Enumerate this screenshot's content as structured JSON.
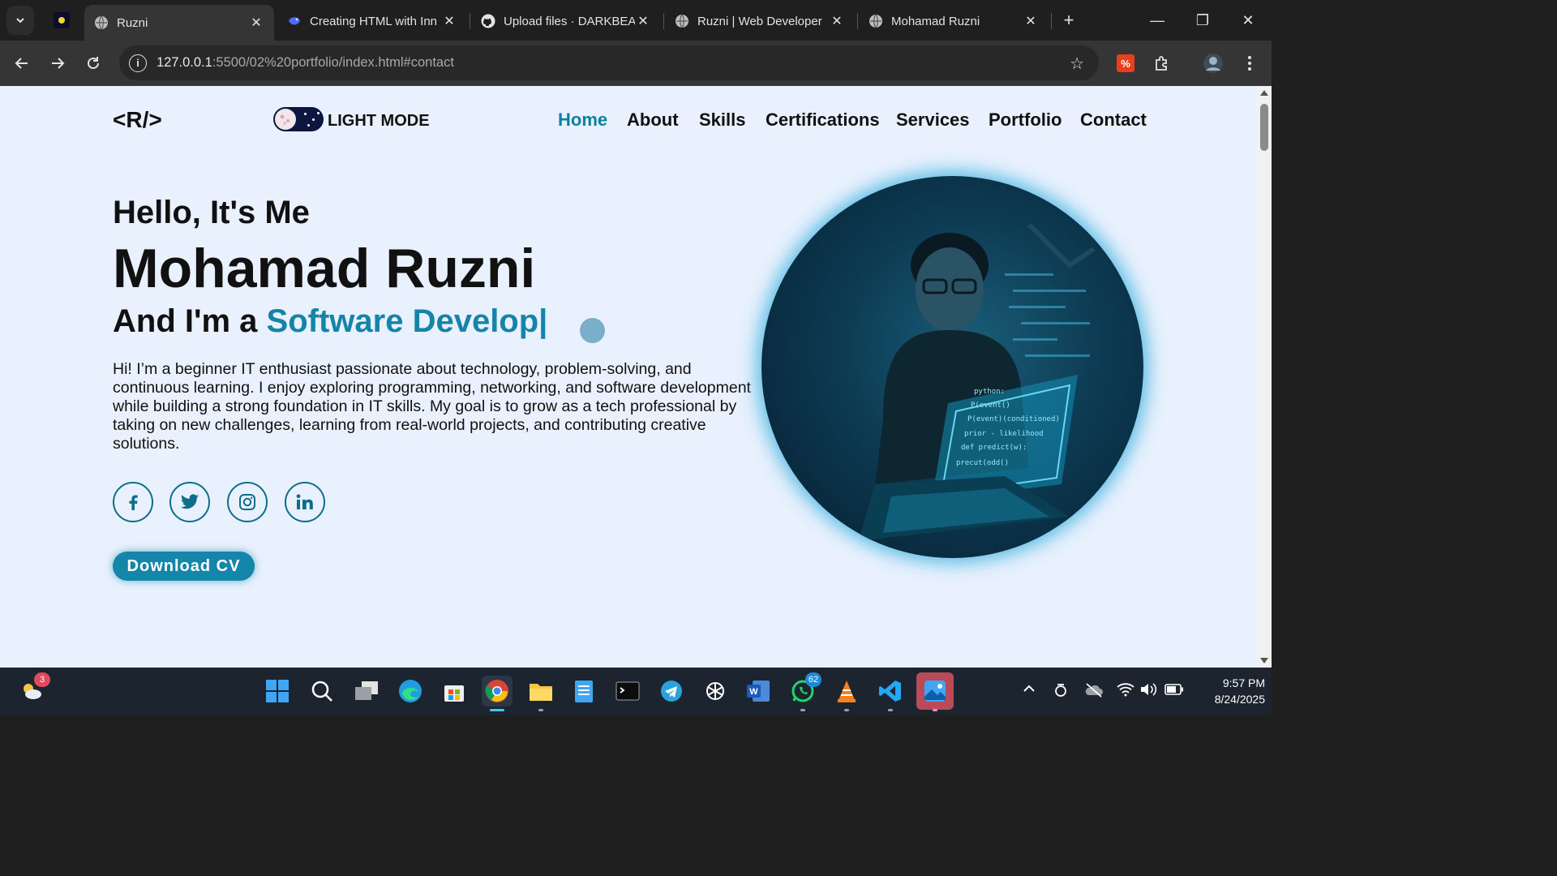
{
  "browser": {
    "tabs": [
      {
        "title": "Ruzni",
        "active": true
      },
      {
        "title": "Creating HTML with Inn",
        "active": false
      },
      {
        "title": "Upload files · DARKBEA",
        "active": false
      },
      {
        "title": "Ruzni | Web Developer",
        "active": false
      },
      {
        "title": "Mohamad Ruzni",
        "active": false
      }
    ],
    "close_glyph": "✕",
    "new_tab_glyph": "+",
    "url_host": "127.0.0.1",
    "url_path": ":5500/02%20portfolio/index.html#contact",
    "window_controls": [
      "—",
      "❐",
      "✕"
    ]
  },
  "page": {
    "logo": "<R/>",
    "mode_label": "LIGHT MODE",
    "nav": [
      "Home",
      "About",
      "Skills",
      "Certifications",
      "Services",
      "Portfolio",
      "Contact"
    ],
    "nav_active": "Home",
    "greeting": "Hello, It's Me",
    "name": "Mohamad Ruzni",
    "role_prefix": "And I'm a ",
    "role_typed": "Software Develop|",
    "bio": "Hi! I’m a beginner IT enthusiast passionate about technology, problem-solving, and continuous learning. I enjoy exploring programming, networking, and software development while building a strong foundation in IT skills. My goal is to grow as a tech professional by taking on new challenges, learning from real-world projects, and contributing creative solutions.",
    "socials": [
      "facebook-icon",
      "twitter-icon",
      "instagram-icon",
      "linkedin-icon"
    ],
    "cv_button": "Download CV",
    "accent_color": "#1584a8",
    "background_color": "#e8f1fd"
  },
  "taskbar": {
    "weather_badge": "3",
    "whatsapp_badge": "62",
    "time": "9:57 PM",
    "date": "8/24/2025"
  }
}
